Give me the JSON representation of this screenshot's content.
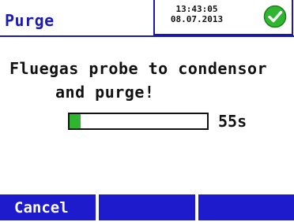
{
  "header": {
    "title": "Purge",
    "time": "13:43:05",
    "date": "08.07.2013",
    "status_icon": "check-circle-icon",
    "status_color": "#2fb52f"
  },
  "message": {
    "line1": "Fluegas probe to condensor",
    "line2": "and purge!"
  },
  "progress": {
    "fraction": 0.08,
    "remaining_label": "55s",
    "fill_color": "#2fb52f"
  },
  "softkeys": [
    {
      "label": "Cancel"
    },
    {
      "label": ""
    },
    {
      "label": ""
    }
  ],
  "colors": {
    "accent": "#1d1bcc",
    "title": "#1b1bb0"
  }
}
